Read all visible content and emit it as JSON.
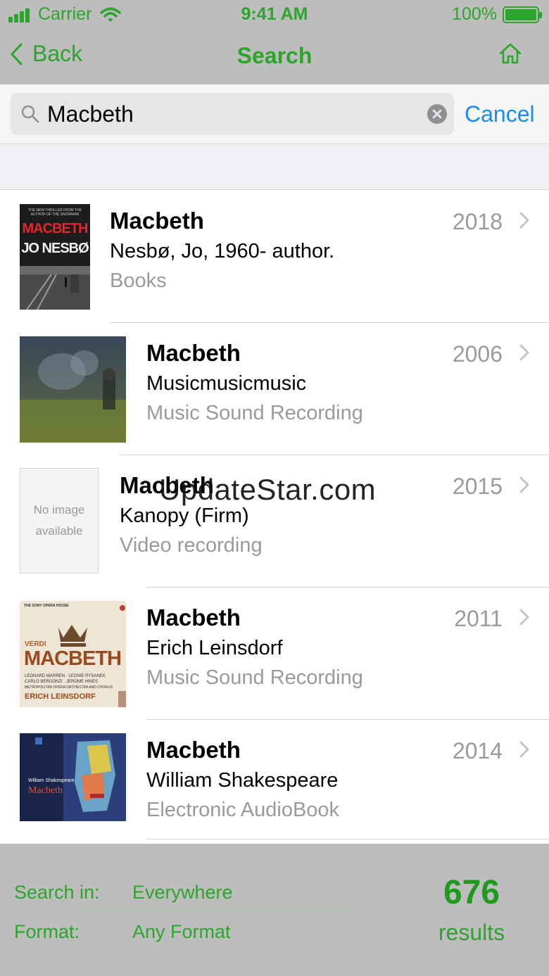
{
  "status_bar": {
    "carrier": "Carrier",
    "time": "9:41 AM",
    "battery": "100%"
  },
  "nav": {
    "back_label": "Back",
    "title": "Search",
    "home_icon": "home-icon"
  },
  "search": {
    "query": "Macbeth",
    "cancel_label": "Cancel"
  },
  "results": [
    {
      "title": "Macbeth",
      "author": "Nesbø, Jo, 1960- author.",
      "format": "Books",
      "year": "2018",
      "cover": {
        "kind": "book",
        "top_line": "THE NEW THRILLER FROM THE AUTHOR OF THE SNOWMAN",
        "line1": "MACBETH",
        "line2": "JO NESBØ"
      }
    },
    {
      "title": "Macbeth",
      "author": "Musicmusicmusic",
      "format": "Music Sound Recording",
      "year": "2006",
      "cover": {
        "kind": "photo"
      }
    },
    {
      "title": "Macbeth",
      "author": "Kanopy (Firm)",
      "format": "Video recording",
      "year": "2015",
      "cover": {
        "kind": "noimage",
        "line1": "No image",
        "line2": "available"
      }
    },
    {
      "title": "Macbeth",
      "author": "Erich Leinsdorf",
      "format": "Music Sound Recording",
      "year": "2011",
      "cover": {
        "kind": "opera",
        "top_line": "THE SONY OPERA HOUSE",
        "composer": "VERDI",
        "work": "MACBETH",
        "credits1": "LEONARD WARREN · LEONIE RYSANEK",
        "credits2": "CARLO BERGONZI · JEROME HINES",
        "credits3": "METROPOLITAN OPERA ORCHESTRA AND CHORUS",
        "conductor": "ERICH LEINSDORF"
      }
    },
    {
      "title": "Macbeth",
      "author": "William Shakespeare",
      "format": "Electronic AudioBook",
      "year": "2014",
      "cover": {
        "kind": "audiobook",
        "author": "William Shakespeare",
        "work": "Macbeth"
      }
    }
  ],
  "watermark": "UpdateStar.com",
  "footer": {
    "search_in_label": "Search in:",
    "search_in_value": "Everywhere",
    "format_label": "Format:",
    "format_value": "Any Format",
    "count": "676",
    "count_label": "results"
  },
  "colors": {
    "accent_green": "#2ba52b",
    "link_blue": "#1a8cf0",
    "bar_gray": "#bdbdbd"
  }
}
